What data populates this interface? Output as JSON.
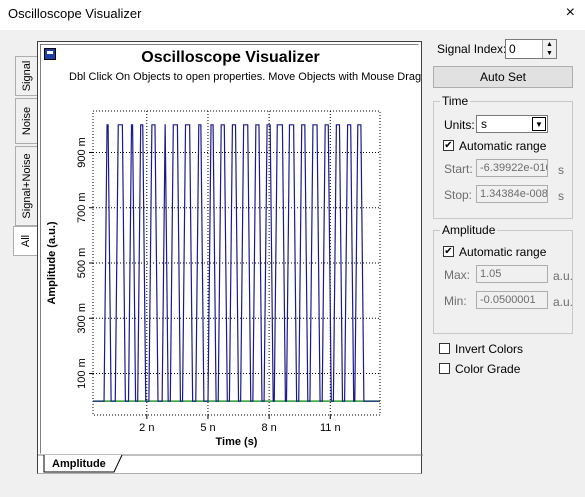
{
  "window": {
    "title": "Oscilloscope Visualizer",
    "close_glyph": "×"
  },
  "side_tabs": [
    {
      "label": "Signal",
      "active": false
    },
    {
      "label": "Noise",
      "active": false
    },
    {
      "label": "Signal+Noise",
      "active": false
    },
    {
      "label": "All",
      "active": true
    }
  ],
  "plot": {
    "title": "Oscilloscope Visualizer",
    "subtitle": "Dbl Click On Objects to open properties.  Move Objects with Mouse Drag",
    "bottom_tab": "Amplitude"
  },
  "chart_data": {
    "type": "line",
    "title": "Oscilloscope Visualizer",
    "xlabel": "Time (s)",
    "ylabel": "Amplitude (a.u.)",
    "x_unit": "s",
    "y_unit": "a.u.",
    "xlim": [
      -6.39922e-10,
      1.34384e-08
    ],
    "ylim": [
      -0.0500001,
      1.05
    ],
    "x_ticks": [
      {
        "v": 2e-09,
        "label": "2 n"
      },
      {
        "v": 5e-09,
        "label": "5 n"
      },
      {
        "v": 8e-09,
        "label": "8 n"
      },
      {
        "v": 1.1e-08,
        "label": "11 n"
      }
    ],
    "y_ticks": [
      {
        "v": 0.1,
        "label": "100 m"
      },
      {
        "v": 0.3,
        "label": "300 m"
      },
      {
        "v": 0.5,
        "label": "500 m"
      },
      {
        "v": 0.7,
        "label": "700 m"
      },
      {
        "v": 0.9,
        "label": "900 m"
      }
    ],
    "grid": true,
    "colors": {
      "signal": "#1a1a8c",
      "baseline": "#2aa02a",
      "grid": "#000000"
    },
    "series": [
      {
        "pulse_high": 1.0,
        "pulse_low": 0.0,
        "pulse_edges_ns": [
          [
            0.0,
            0.15
          ],
          [
            0.55,
            0.85
          ],
          [
            1.2,
            1.35
          ],
          [
            1.65,
            1.85
          ],
          [
            2.2,
            2.45
          ],
          [
            2.85,
            2.95
          ],
          [
            3.25,
            3.55
          ],
          [
            3.85,
            4.15
          ],
          [
            4.5,
            4.7
          ],
          [
            5.1,
            5.3
          ],
          [
            5.6,
            5.85
          ],
          [
            6.15,
            6.4
          ],
          [
            6.7,
            7.0
          ],
          [
            7.3,
            7.55
          ],
          [
            7.85,
            8.1
          ],
          [
            8.35,
            8.7
          ],
          [
            8.95,
            9.25
          ],
          [
            9.55,
            9.8
          ],
          [
            10.1,
            10.4
          ],
          [
            10.7,
            10.95
          ],
          [
            11.25,
            11.5
          ],
          [
            11.8,
            12.05
          ],
          [
            12.3,
            12.55
          ]
        ]
      }
    ]
  },
  "controls": {
    "signal_index_label": "Signal Index:",
    "signal_index_value": "0",
    "auto_set_label": "Auto Set",
    "time": {
      "group_label": "Time",
      "units_label": "Units:",
      "units_value": "s",
      "auto_range_label": "Automatic range",
      "auto_range_checked": true,
      "start_label": "Start:",
      "start_value": "-6.39922e-010",
      "start_unit": "s",
      "stop_label": "Stop:",
      "stop_value": "1.34384e-008",
      "stop_unit": "s"
    },
    "amplitude": {
      "group_label": "Amplitude",
      "auto_range_label": "Automatic range",
      "auto_range_checked": true,
      "max_label": "Max:",
      "max_value": "1.05",
      "max_unit": "a.u.",
      "min_label": "Min:",
      "min_value": "-0.0500001",
      "min_unit": "a.u."
    },
    "invert_colors_label": "Invert Colors",
    "invert_colors_checked": false,
    "color_grade_label": "Color Grade",
    "color_grade_checked": false
  }
}
